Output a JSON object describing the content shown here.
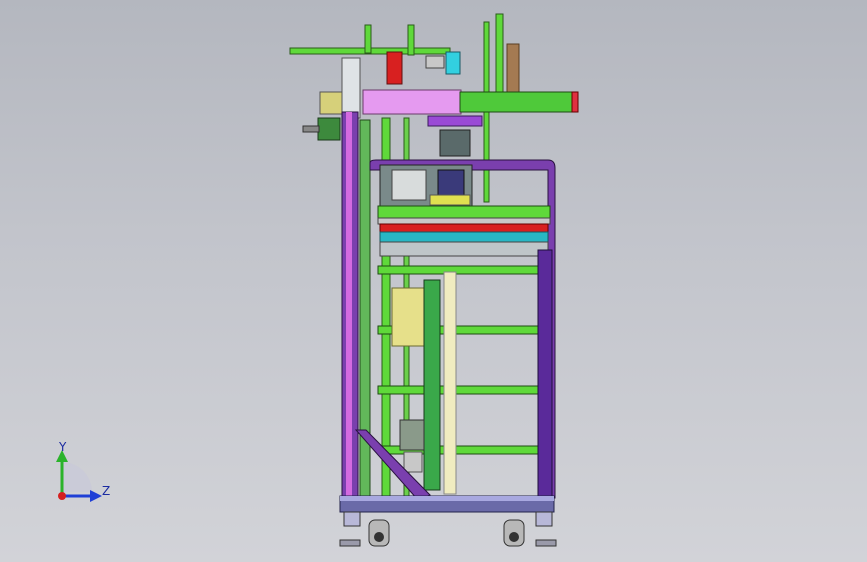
{
  "colors": {
    "background_top": "#b4b7bf",
    "background_bottom": "#d2d3d8",
    "frame_green": "#5fd93a",
    "frame_purple": "#7a3fae",
    "pink_block": "#e59af0",
    "red_part": "#d82020",
    "yellow_panel": "#e6e08a",
    "axis_y": "#2bb32b",
    "axis_z": "#1f3fd6",
    "axis_x": "#d42020",
    "label_color": "#1a2aa0"
  },
  "triad": {
    "y_label": "Y",
    "z_label": "Z",
    "icons": [
      "y-axis-arrow-icon",
      "z-axis-arrow-icon",
      "x-axis-dot-icon"
    ]
  }
}
